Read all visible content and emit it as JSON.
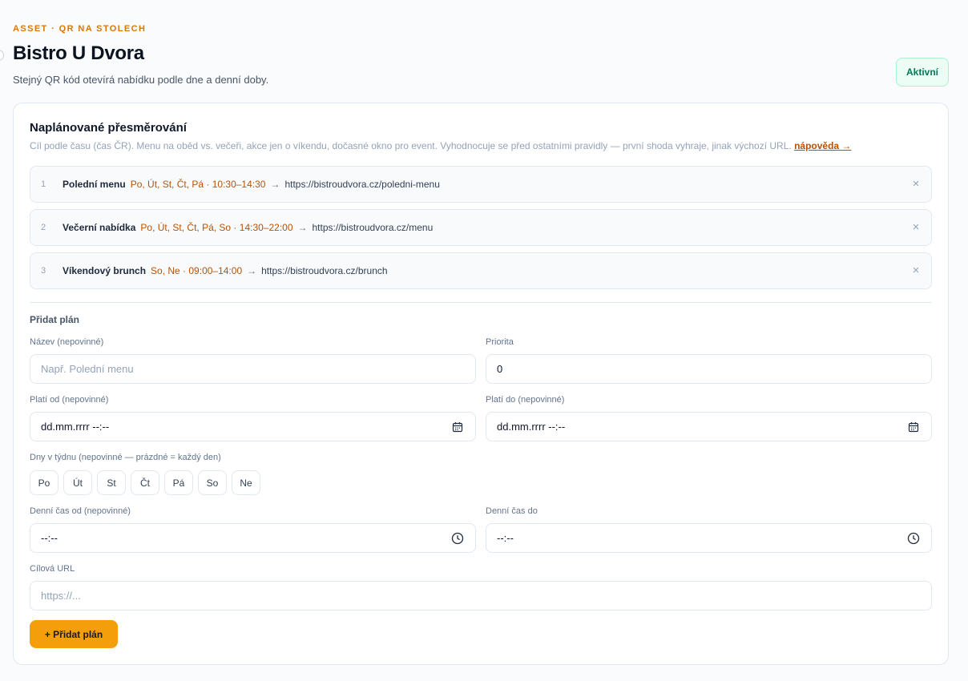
{
  "header": {
    "eyebrow": "ASSET · QR NA STOLECH",
    "title": "Bistro U Dvora",
    "subtitle": "Stejný QR kód otevírá nabídku podle dne a denní doby.",
    "status": "Aktivní"
  },
  "scheduled": {
    "title": "Naplánované přesměrování",
    "description": "Cíl podle času (čas ČR). Menu na oběd vs. večeři, akce jen o víkendu, dočasné okno pro event. Vyhodnocuje se před ostatními pravidly — první shoda vyhraje, jinak výchozí URL.",
    "help_link": "nápověda →",
    "rules": [
      {
        "index": "1",
        "name": "Polední menu",
        "schedule": "Po, Út, St, Čt, Pá · 10:30–14:30",
        "arrow": "→",
        "url": "https://bistroudvora.cz/poledni-menu",
        "remove": "×"
      },
      {
        "index": "2",
        "name": "Večerní nabídka",
        "schedule": "Po, Út, St, Čt, Pá, So · 14:30–22:00",
        "arrow": "→",
        "url": "https://bistroudvora.cz/menu",
        "remove": "×"
      },
      {
        "index": "3",
        "name": "Víkendový brunch",
        "schedule": "So, Ne · 09:00–14:00",
        "arrow": "→",
        "url": "https://bistroudvora.cz/brunch",
        "remove": "×"
      }
    ]
  },
  "form": {
    "title": "Přidat plán",
    "name_label": "Název (nepovinné)",
    "name_placeholder": "Např. Polední menu",
    "priority_label": "Priorita",
    "priority_value": "0",
    "valid_from_label": "Platí od (nepovinné)",
    "valid_from_value": "dd.mm.rrrr --:--",
    "valid_to_label": "Platí do (nepovinné)",
    "valid_to_value": "dd.mm.rrrr --:--",
    "days_label": "Dny v týdnu (nepovinné — prázdné = každý den)",
    "days": [
      "Po",
      "Út",
      "St",
      "Čt",
      "Pá",
      "So",
      "Ne"
    ],
    "time_from_label": "Denní čas od (nepovinné)",
    "time_from_value": "--:--",
    "time_to_label": "Denní čas do",
    "time_to_value": "--:--",
    "url_label": "Cílová URL",
    "url_placeholder": "https://...",
    "submit_label": "+ Přidat plán"
  },
  "icons": {
    "calendar": "calendar-icon",
    "clock": "clock-icon",
    "close": "close-icon"
  },
  "colors": {
    "accent": "#f59e0b",
    "schedule_text": "#b45309",
    "status_green": "#047857"
  }
}
